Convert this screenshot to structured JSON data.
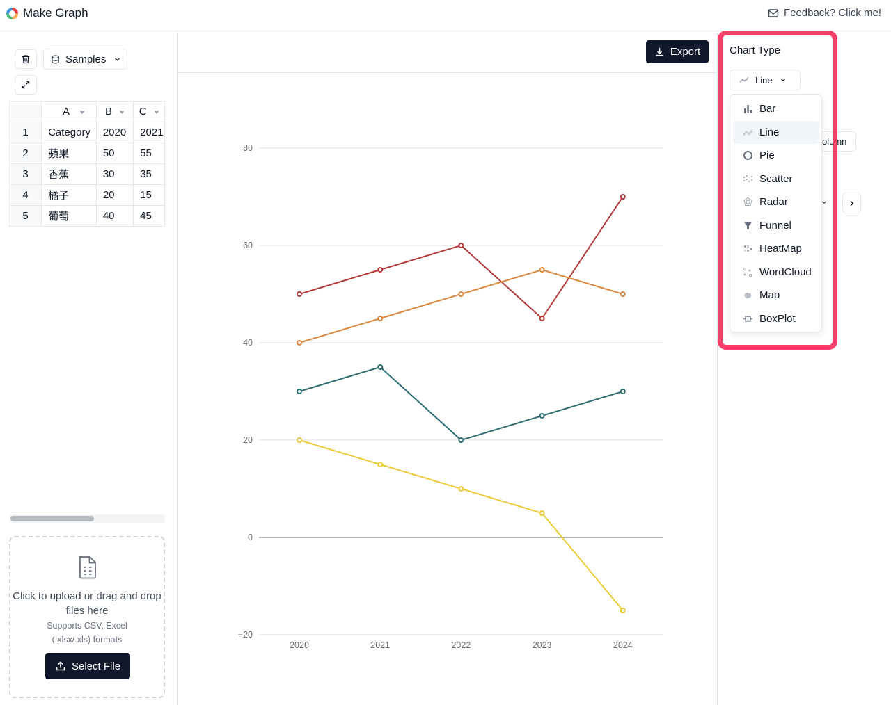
{
  "header": {
    "title": "Make Graph",
    "feedback": "Feedback? Click me!"
  },
  "left": {
    "samples_label": "Samples",
    "grid": {
      "columns": [
        "A",
        "B",
        "C"
      ],
      "rows": [
        [
          "1",
          "Category",
          "2020",
          "2021"
        ],
        [
          "2",
          "蘋果",
          "50",
          "55"
        ],
        [
          "3",
          "香蕉",
          "30",
          "35"
        ],
        [
          "4",
          "橘子",
          "20",
          "15"
        ],
        [
          "5",
          "葡萄",
          "40",
          "45"
        ]
      ]
    },
    "upload": {
      "click_text": "Click to upload",
      "rest_text": "or drag and drop files here",
      "supports": "Supports CSV, Excel (.xlsx/.xls) formats",
      "button": "Select File"
    }
  },
  "toolbar": {
    "export_label": "Export"
  },
  "right": {
    "chart_type_label": "Chart Type",
    "selected_type": "Line",
    "hidden_button_partial": "olumn",
    "chart_types": [
      "Bar",
      "Line",
      "Pie",
      "Scatter",
      "Radar",
      "Funnel",
      "HeatMap",
      "WordCloud",
      "Map",
      "BoxPlot"
    ],
    "active_index": 1
  },
  "chart_data": {
    "type": "line",
    "x": [
      "2020",
      "2021",
      "2022",
      "2023",
      "2024"
    ],
    "ylim": [
      -20,
      80
    ],
    "yticks": [
      "80",
      "60",
      "40",
      "20",
      "0",
      "−20"
    ],
    "series": [
      {
        "color": "#b33a3a",
        "values": [
          50,
          55,
          60,
          45,
          70
        ]
      },
      {
        "color": "#d9883d",
        "values": [
          40,
          45,
          50,
          55,
          50
        ]
      },
      {
        "color": "#2e6d74",
        "values": [
          30,
          35,
          20,
          25,
          30
        ]
      },
      {
        "color": "#eecb3a",
        "values": [
          20,
          15,
          10,
          5,
          -15
        ]
      }
    ]
  }
}
